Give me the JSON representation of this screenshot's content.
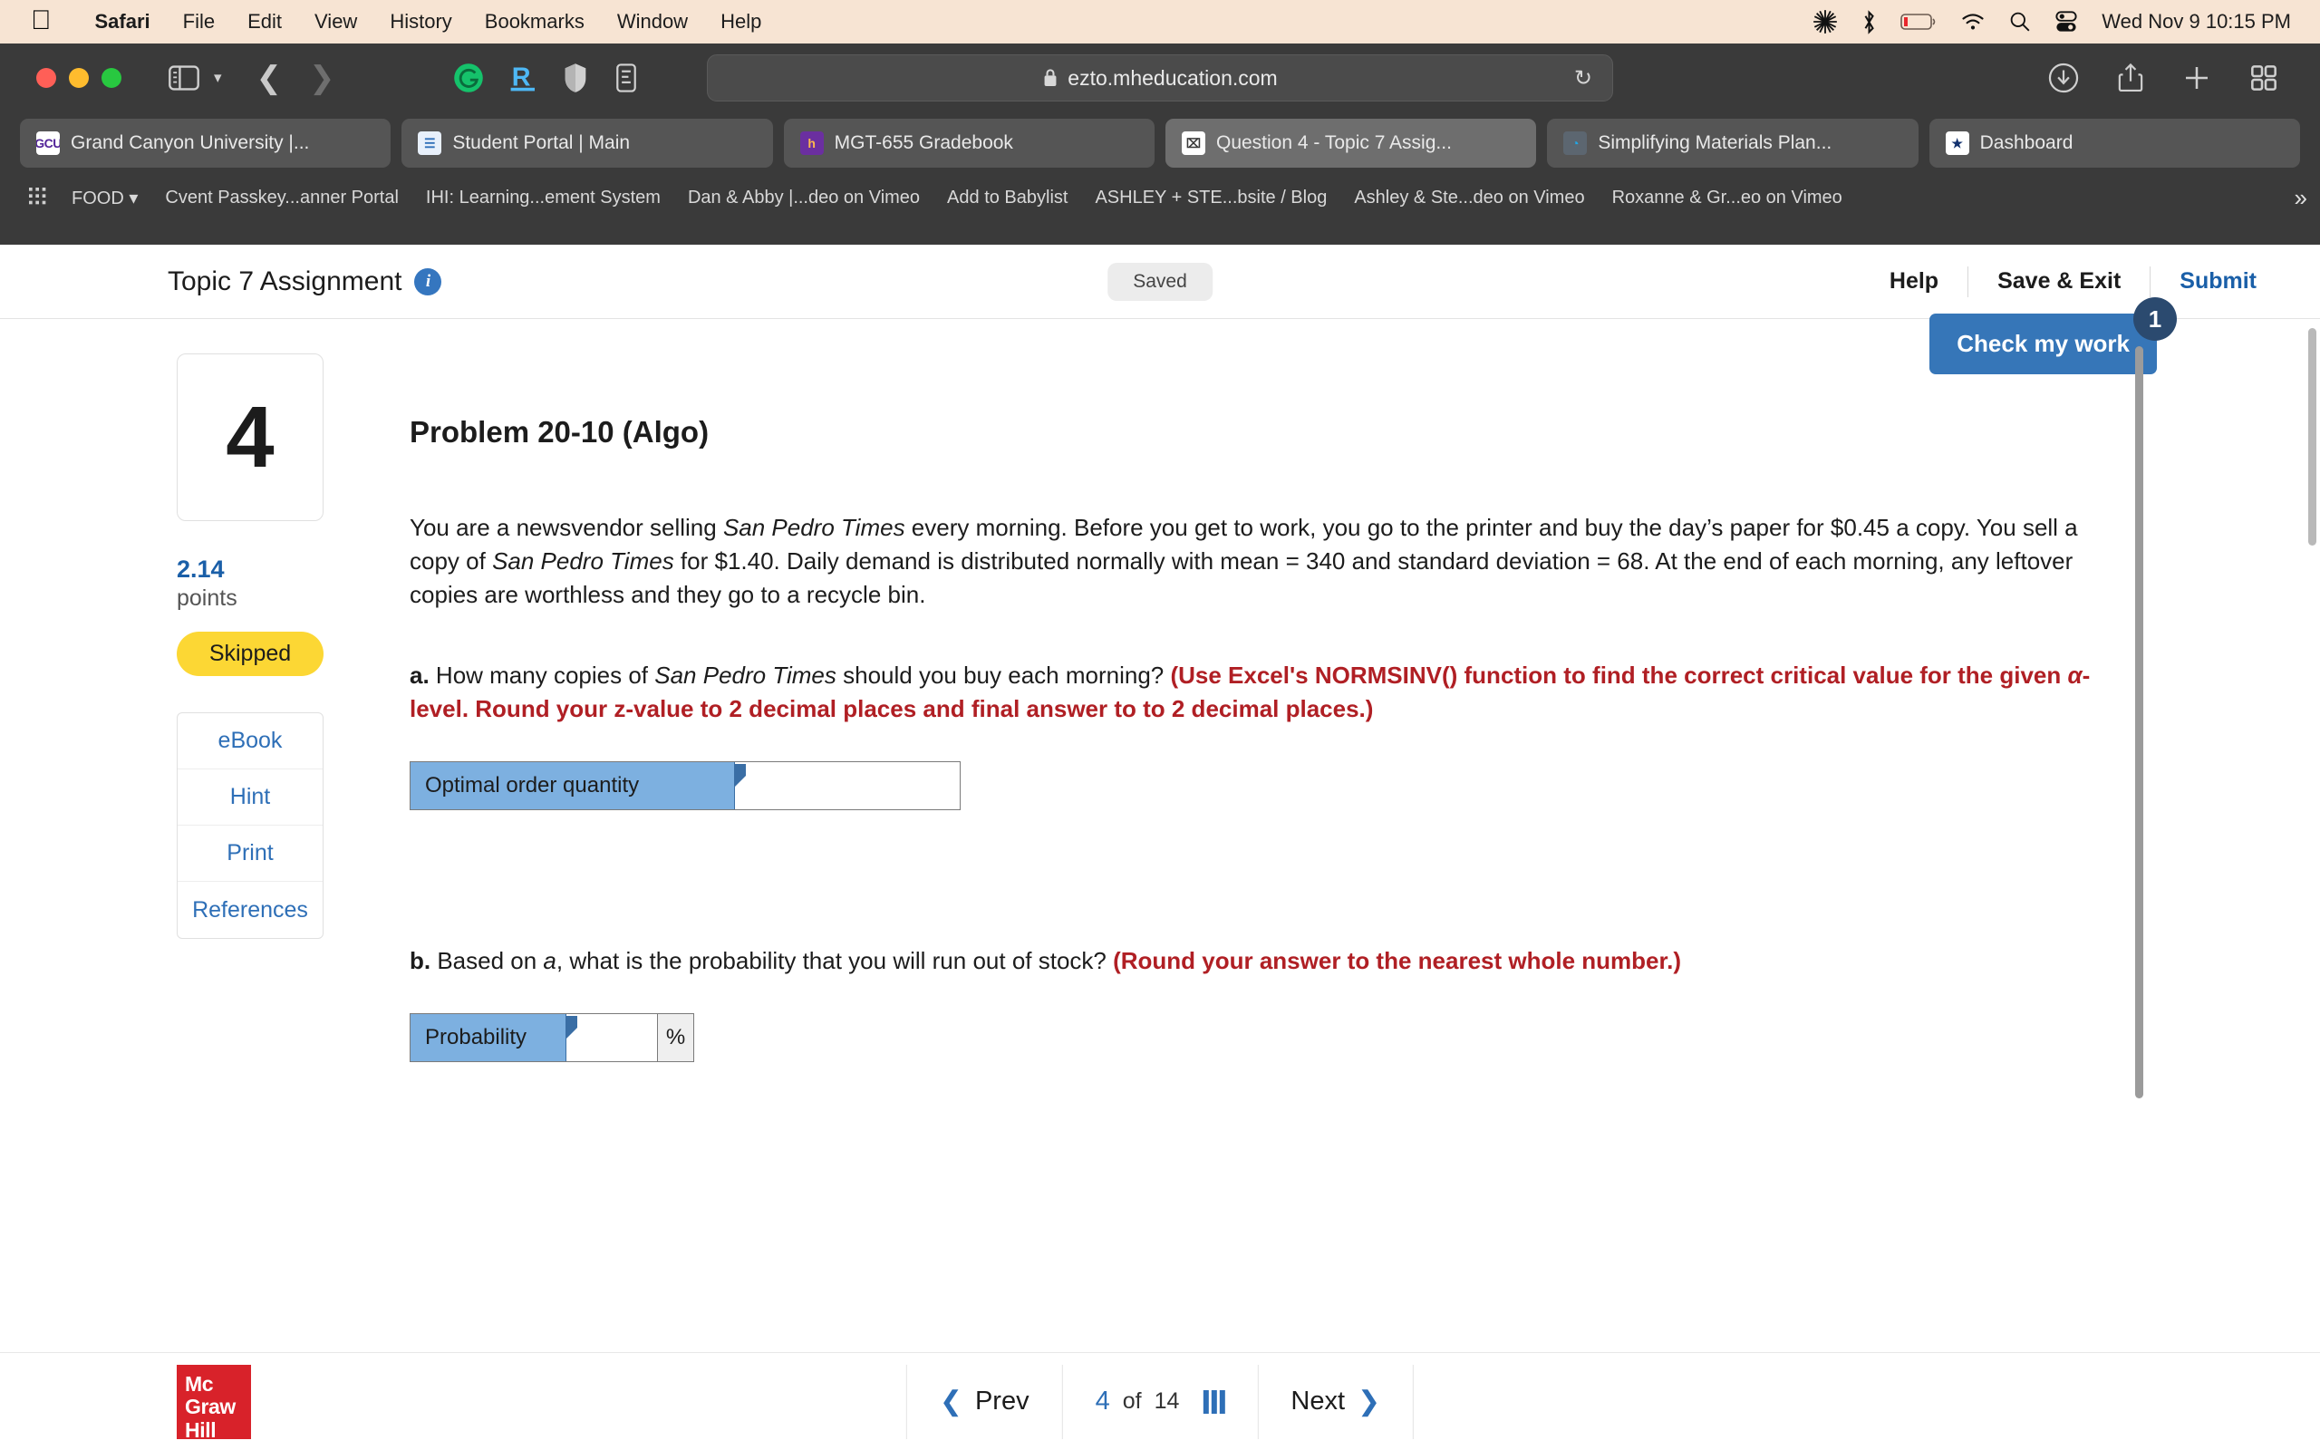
{
  "macos_menu": {
    "apple_icon": "apple-icon",
    "items": [
      {
        "label": "Safari",
        "bold": true
      },
      {
        "label": "File",
        "bold": false
      },
      {
        "label": "Edit",
        "bold": false
      },
      {
        "label": "View",
        "bold": false
      },
      {
        "label": "History",
        "bold": false
      },
      {
        "label": "Bookmarks",
        "bold": false
      },
      {
        "label": "Window",
        "bold": false
      },
      {
        "label": "Help",
        "bold": false
      }
    ],
    "status_icons": [
      "sun-burst-icon",
      "bluetooth-icon",
      "battery-low-icon",
      "wifi-icon",
      "search-icon",
      "control-center-icon"
    ],
    "clock": "Wed Nov 9  10:15 PM",
    "bar_color": "#f7e4d3"
  },
  "browser": {
    "window_controls": [
      "close-button",
      "minimize-button",
      "zoom-button"
    ],
    "url": "ezto.mheducation.com",
    "url_secure_icon": "lock-icon",
    "reload_icon": "reload-icon",
    "extension_icons": [
      "grammarly-icon",
      "rakuten-icon",
      "shield-icon",
      "reader-icon"
    ],
    "toolbar_right_icons": [
      "downloads-icon",
      "share-icon",
      "new-tab-icon",
      "tab-overview-icon"
    ],
    "tabs": [
      {
        "label": "Grand Canyon University |...",
        "favicon": "gcu-icon",
        "fav_text": "GCU",
        "fav_class": "fav-gcu",
        "active": false
      },
      {
        "label": "Student Portal | Main",
        "favicon": "student-portal-icon",
        "fav_text": "☰",
        "fav_class": "fav-sp",
        "active": false
      },
      {
        "label": "MGT-655 Gradebook",
        "favicon": "halo-icon",
        "fav_text": "h",
        "fav_class": "fav-mgt",
        "active": false
      },
      {
        "label": "Question 4 - Topic 7 Assig...",
        "favicon": "x-icon",
        "fav_text": "⌧",
        "fav_class": "fav-q4",
        "active": true
      },
      {
        "label": "Simplifying Materials Plan...",
        "favicon": "simplifying-icon",
        "fav_text": "◔",
        "fav_class": "fav-sim",
        "active": false
      },
      {
        "label": "Dashboard",
        "favicon": "star-shield-icon",
        "fav_text": "★",
        "fav_class": "fav-dash",
        "active": false
      }
    ],
    "bookmarks": {
      "grid_icon": "bookmarks-grid-icon",
      "items": [
        {
          "label": "FOOD",
          "has_chevron": true
        },
        {
          "label": "Cvent Passkey...anner Portal",
          "has_chevron": false
        },
        {
          "label": "IHI: Learning...ement System",
          "has_chevron": false
        },
        {
          "label": "Dan & Abby |...deo on Vimeo",
          "has_chevron": false
        },
        {
          "label": "Add to Babylist",
          "has_chevron": false
        },
        {
          "label": "ASHLEY + STE...bsite / Blog",
          "has_chevron": false
        },
        {
          "label": "Ashley & Ste...deo on Vimeo",
          "has_chevron": false
        },
        {
          "label": "Roxanne & Gr...eo on Vimeo",
          "has_chevron": false
        }
      ],
      "overflow_icon": "chevron-double-right-icon"
    }
  },
  "assignment": {
    "title": "Topic 7 Assignment",
    "info_icon": "info-icon",
    "info_glyph": "i",
    "save_status": "Saved",
    "actions": [
      {
        "label": "Help",
        "accent": false
      },
      {
        "label": "Save & Exit",
        "accent": false
      },
      {
        "label": "Submit",
        "accent": true
      }
    ],
    "accent_color": "#1a5fa8"
  },
  "question": {
    "number": "4",
    "points_value": "2.14",
    "points_label": "points",
    "status_badge": "Skipped",
    "status_badge_color": "#fcd734",
    "side_buttons": [
      "eBook",
      "Hint",
      "Print",
      "References"
    ],
    "check_my_work": {
      "label": "Check my work",
      "badge": "1",
      "color": "#3676b8"
    },
    "problem_title": "Problem 20-10 (Algo)",
    "stem_parts": [
      {
        "text": "You are a newsvendor selling ",
        "italic": false
      },
      {
        "text": "San Pedro Times",
        "italic": true
      },
      {
        "text": " every morning. Before you get to work, you go to the printer and buy the day’s paper for $0.45 a copy. You sell a copy of ",
        "italic": false
      },
      {
        "text": "San Pedro Times",
        "italic": true
      },
      {
        "text": " for $1.40. Daily demand is distributed normally with mean = 340 and standard deviation = 68. At the end of each morning, any leftover copies are worthless and they go to a recycle bin.",
        "italic": false
      }
    ],
    "parts": [
      {
        "id": "a",
        "letter": "a.",
        "prompt_parts": [
          {
            "text": " How many copies of ",
            "italic": false,
            "red": false
          },
          {
            "text": "San Pedro Times",
            "italic": true,
            "red": false
          },
          {
            "text": " should you buy each morning? ",
            "italic": false,
            "red": false
          },
          {
            "text": "(Use Excel's NORMSINV() function to find the correct critical value for the given ",
            "italic": false,
            "red": true
          },
          {
            "text": "α",
            "italic": true,
            "red": true
          },
          {
            "text": "-level. Round your z-value to 2 decimal places and final answer to to 2 decimal places.)",
            "italic": false,
            "red": true
          }
        ],
        "answer_label": "Optimal order quantity",
        "answer_value": "",
        "answer_placeholder": "",
        "unit": ""
      },
      {
        "id": "b",
        "letter": "b.",
        "prompt_parts": [
          {
            "text": " Based on ",
            "italic": false,
            "red": false
          },
          {
            "text": "a",
            "italic": true,
            "red": false
          },
          {
            "text": ", what is the probability that you will run out of stock? ",
            "italic": false,
            "red": false
          },
          {
            "text": "(Round your answer to the nearest whole number.)",
            "italic": false,
            "red": true
          }
        ],
        "answer_label": "Probability",
        "answer_value": "",
        "answer_placeholder": "",
        "unit": "%"
      }
    ]
  },
  "footer": {
    "logo_lines": [
      "Mc",
      "Graw",
      "Hill"
    ],
    "logo_color": "#d8222a",
    "prev_label": "Prev",
    "next_label": "Next",
    "current_page": "4",
    "of_label": "of",
    "total_pages": "14",
    "grid_icon": "question-grid-icon"
  }
}
